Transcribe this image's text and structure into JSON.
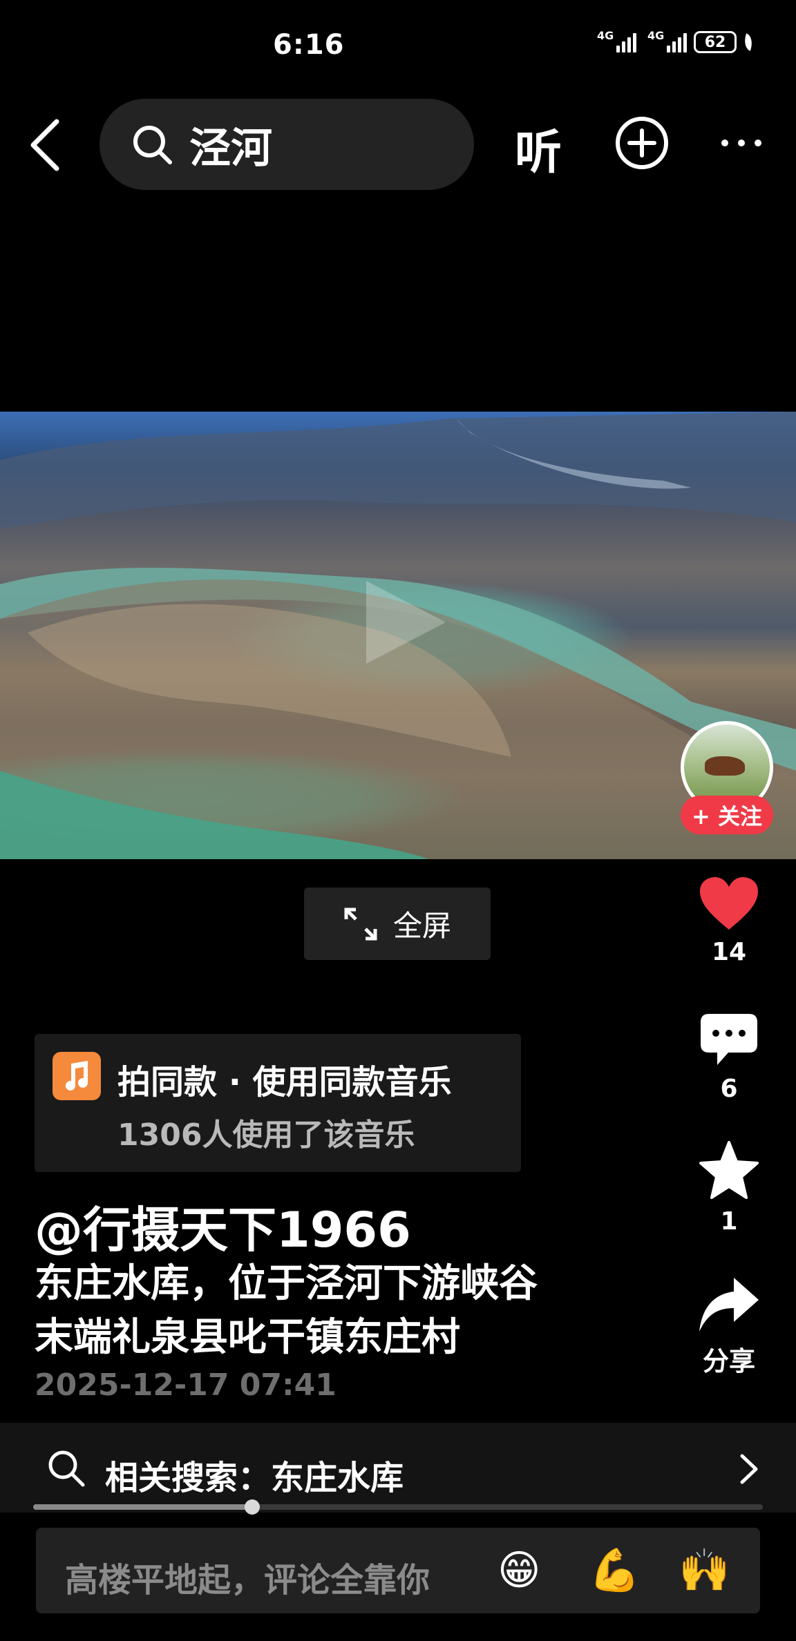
{
  "status_bar": {
    "time": "6:16",
    "signal_1_label": "4G",
    "signal_2_label": "4G",
    "battery": "62"
  },
  "header": {
    "search_query": "泾河",
    "listen_label": "听"
  },
  "video": {
    "follow_label": "+ 关注",
    "fullscreen_label": "全屏"
  },
  "actions": {
    "likes": "14",
    "comments": "6",
    "favorites": "1",
    "share_label": "分享",
    "like_color": "#f03a47"
  },
  "music": {
    "title": "拍同款 · 使用同款音乐",
    "usage": "1306人使用了该音乐"
  },
  "post": {
    "author": "@行摄天下1966",
    "description_line1": "东庄水库，位于泾河下游峡谷",
    "description_line2": "末端礼泉县叱干镇东庄村",
    "date": "2025-12-17 07:41"
  },
  "related_search": {
    "prefix": "相关搜索：",
    "term": "东庄水库"
  },
  "playback_progress": 0.3,
  "comment_bar": {
    "placeholder": "高楼平地起，评论全靠你",
    "emojis": [
      "😁",
      "💪",
      "🙌"
    ]
  }
}
